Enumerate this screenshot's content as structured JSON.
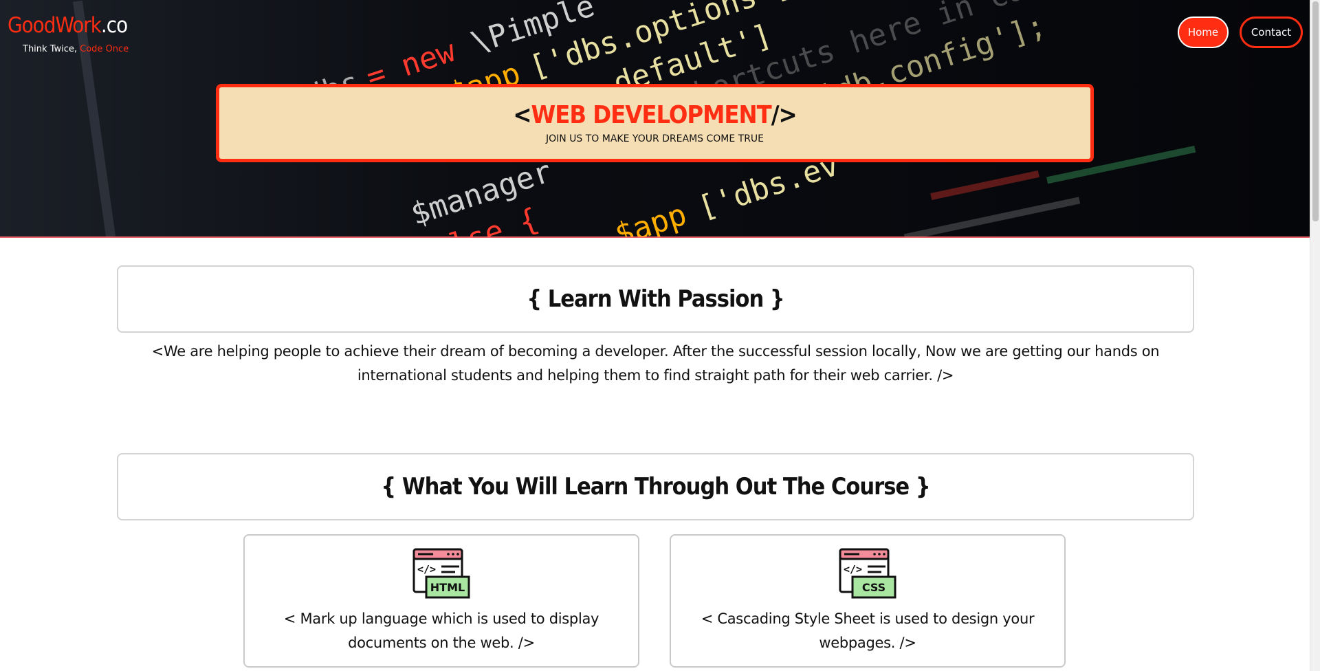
{
  "brand": {
    "name_part1": "Good",
    "name_part2": "Work",
    "name_part3": ".co",
    "tagline_part1": "Think Twice, ",
    "tagline_part2": "Code Once"
  },
  "nav": {
    "home_label": "Home",
    "contact_label": "Contact"
  },
  "hero": {
    "heading_open": "<",
    "heading_main": "WEB DEVELOPMENT",
    "heading_close": "/>",
    "subheading": "JOIN US TO MAKE YOUR DREAMS COME TRUE"
  },
  "learn": {
    "title": "{ Learn With Passion }",
    "description": "<We are helping people to achieve their dream of becoming a developer. After the successful session locally, Now we are getting our hands on international students and helping them to find straight path for their web carrier. />"
  },
  "course": {
    "title": "{ What You Will Learn Through Out The Course }",
    "cards": [
      {
        "icon": "html-icon",
        "badge": "HTML",
        "text": "< Mark up language which is used to display documents on the web. />"
      },
      {
        "icon": "css-icon",
        "badge": "CSS",
        "text": "< Cascading Style Sheet is used to design your webpages. />"
      }
    ]
  },
  "colors": {
    "accent": "#ff2d12",
    "hero_card_bg": "#f5deb3",
    "hero_bg": "#0a0c12",
    "icon_pink": "#f28b9a",
    "icon_green": "#a8e6a1"
  }
}
